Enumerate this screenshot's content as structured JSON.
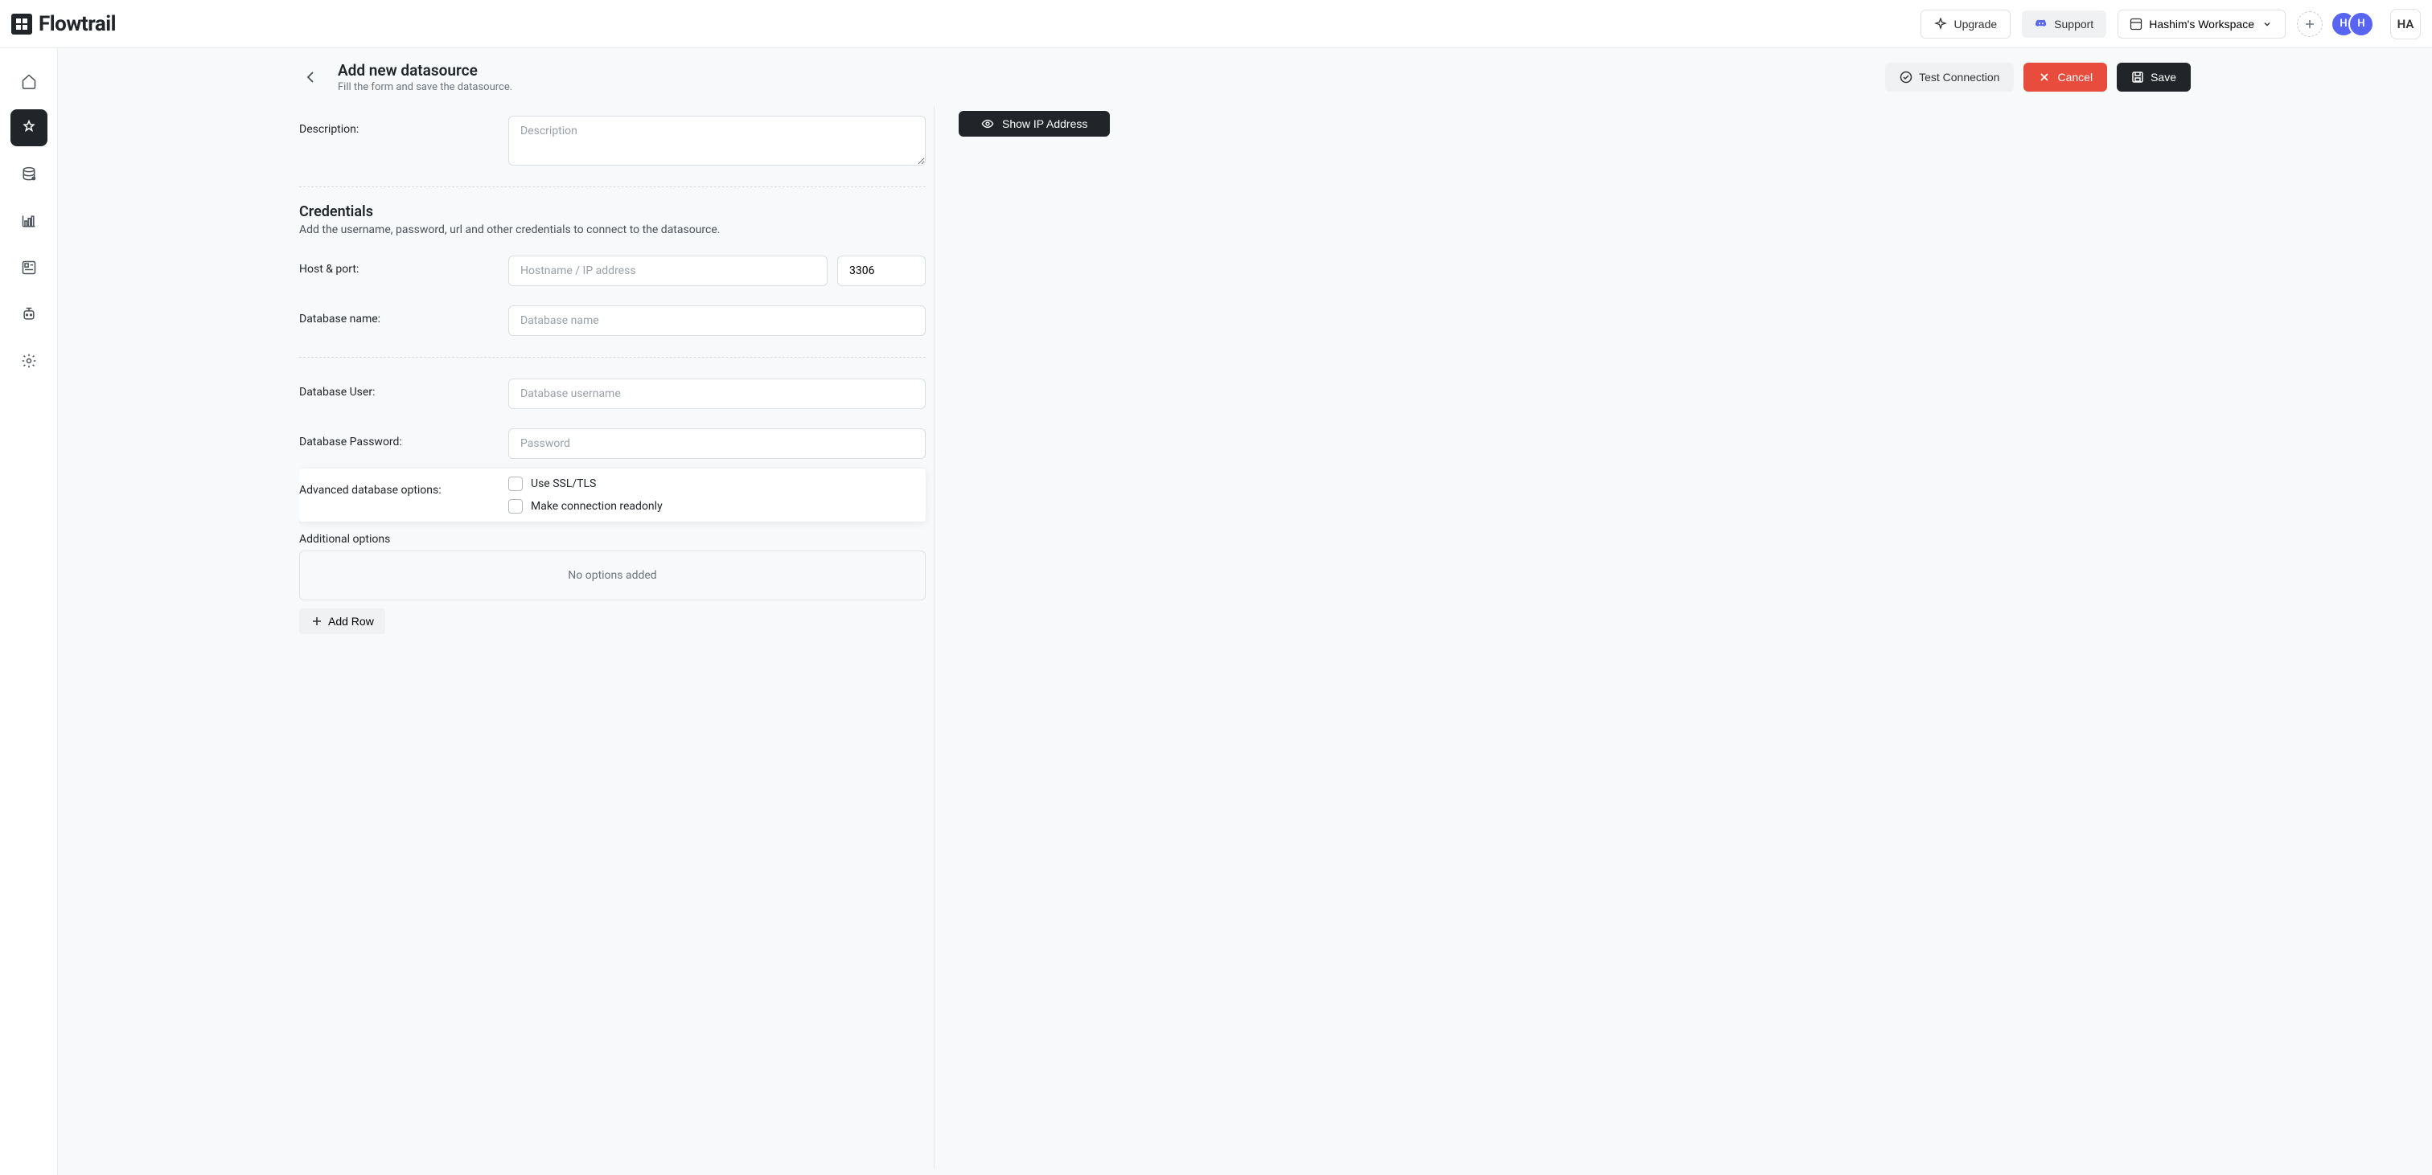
{
  "brand": {
    "name": "Flowtrail"
  },
  "top": {
    "upgrade": "Upgrade",
    "support": "Support",
    "workspace": "Hashim's Workspace",
    "avatar1": "H",
    "avatar2": "H",
    "avatar_solo": "HA"
  },
  "page": {
    "title": "Add new datasource",
    "subtitle": "Fill the form and save the datasource.",
    "test_connection": "Test Connection",
    "cancel": "Cancel",
    "save": "Save",
    "show_ip": "Show IP Address"
  },
  "form": {
    "description_label": "Description:",
    "description_placeholder": "Description",
    "description_value": "",
    "creds_title": "Credentials",
    "creds_sub": "Add the username, password, url and other credentials to connect to the datasource.",
    "host_label": "Host & port:",
    "host_placeholder": "Hostname / IP address",
    "host_value": "",
    "port_value": "3306",
    "dbname_label": "Database name:",
    "dbname_placeholder": "Database name",
    "dbname_value": "",
    "dbuser_label": "Database User:",
    "dbuser_placeholder": "Database username",
    "dbuser_value": "",
    "dbpass_label": "Database Password:",
    "dbpass_placeholder": "Password",
    "dbpass_value": "",
    "adv_label": "Advanced database options:",
    "adv_ssl": "Use SSL/TLS",
    "adv_readonly": "Make connection readonly",
    "addl_title": "Additional options",
    "no_options": "No options added",
    "add_row": "Add Row"
  }
}
